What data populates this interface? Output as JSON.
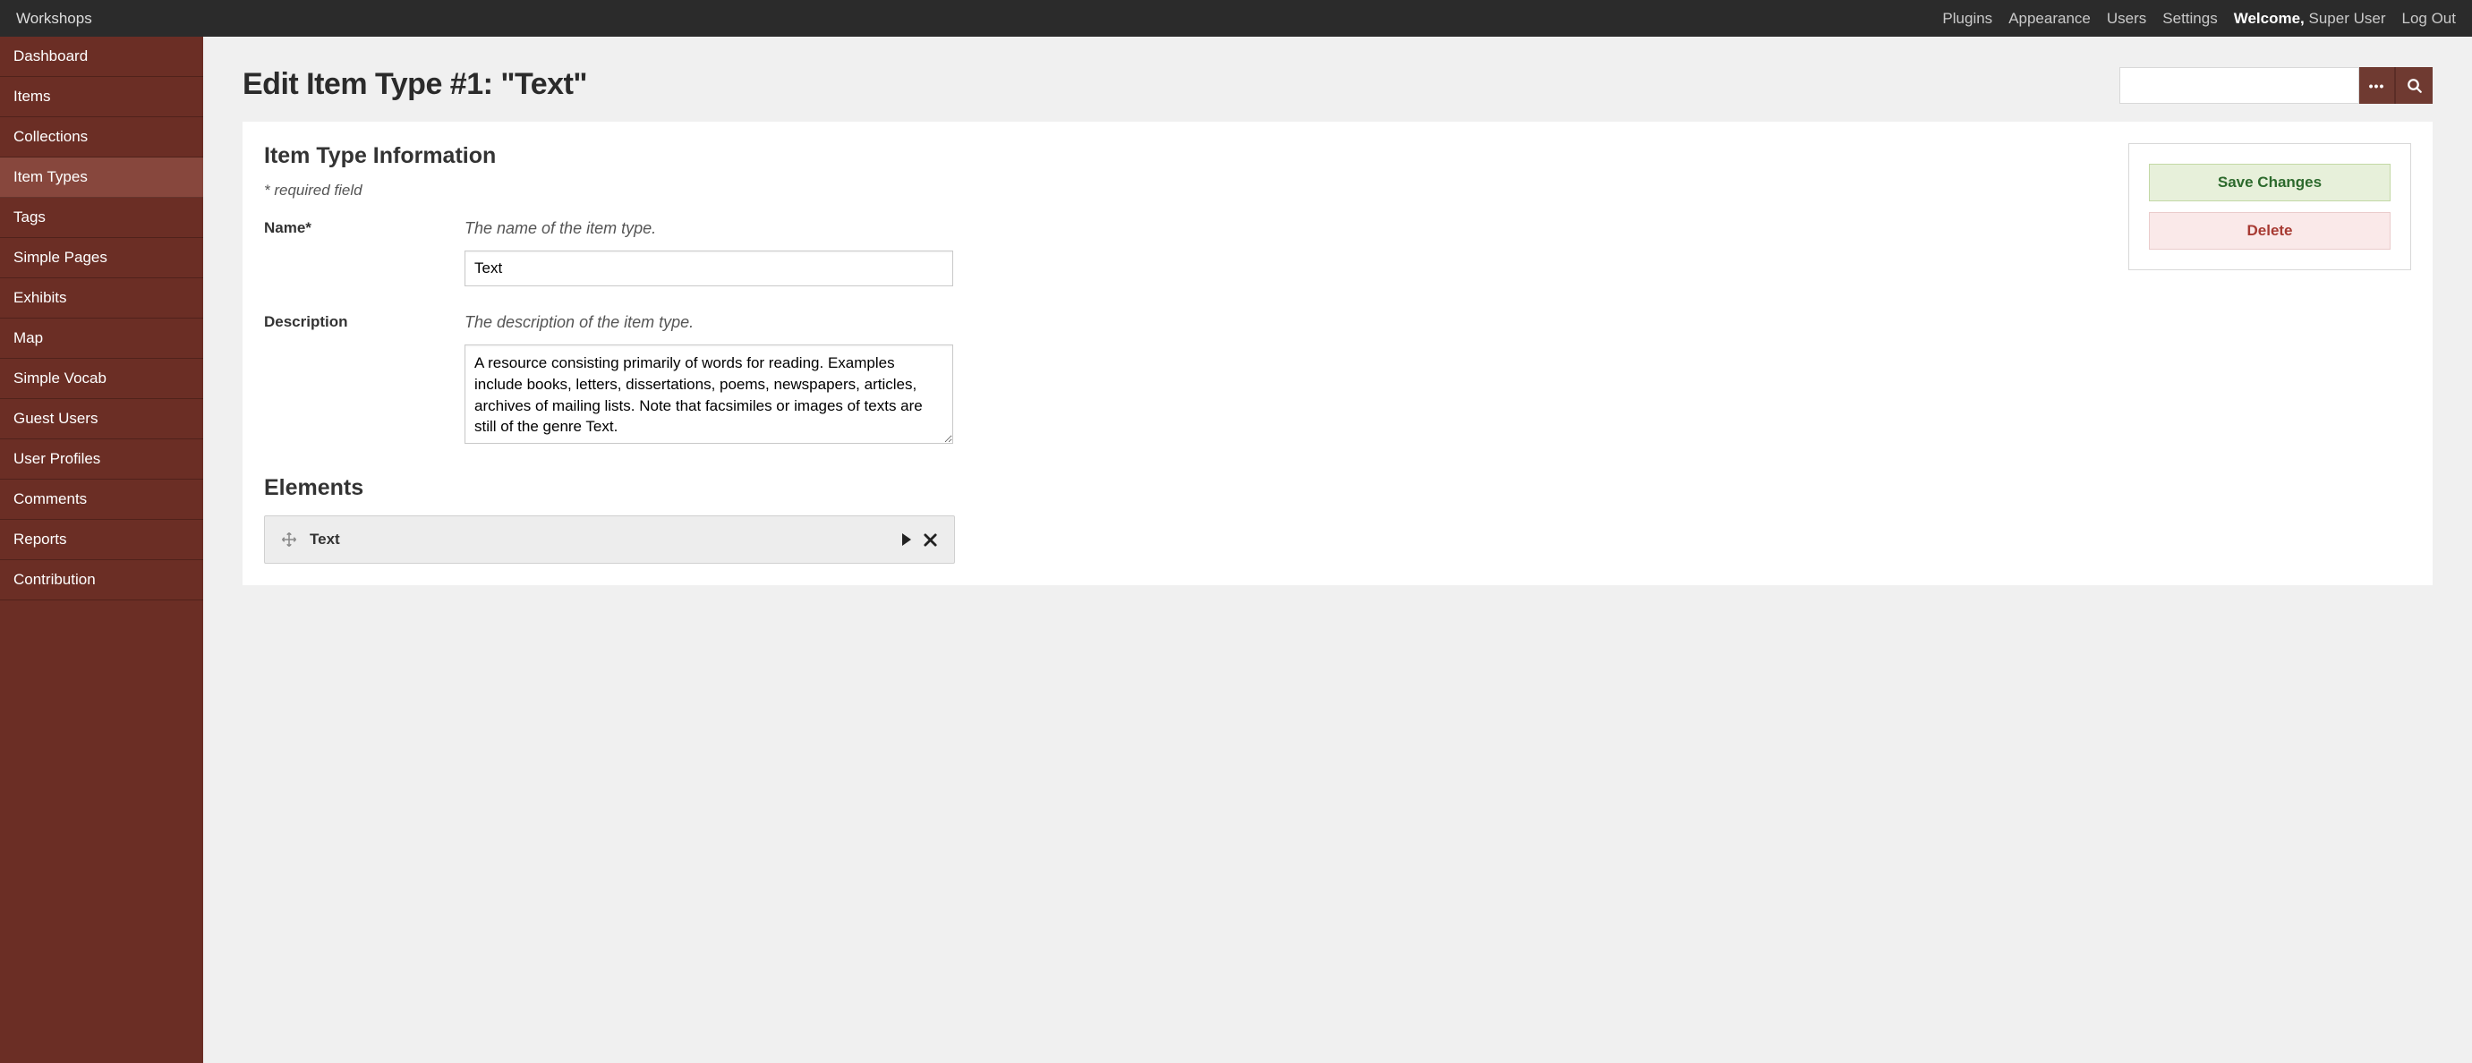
{
  "topbar": {
    "brand": "Workshops",
    "links": {
      "plugins": "Plugins",
      "appearance": "Appearance",
      "users": "Users",
      "settings": "Settings",
      "logout": "Log Out"
    },
    "welcome_label": "Welcome,",
    "welcome_user": "Super User"
  },
  "sidebar": {
    "items": [
      {
        "label": "Dashboard",
        "active": false
      },
      {
        "label": "Items",
        "active": false
      },
      {
        "label": "Collections",
        "active": false
      },
      {
        "label": "Item Types",
        "active": true
      },
      {
        "label": "Tags",
        "active": false
      },
      {
        "label": "Simple Pages",
        "active": false
      },
      {
        "label": "Exhibits",
        "active": false
      },
      {
        "label": "Map",
        "active": false
      },
      {
        "label": "Simple Vocab",
        "active": false
      },
      {
        "label": "Guest Users",
        "active": false
      },
      {
        "label": "User Profiles",
        "active": false
      },
      {
        "label": "Comments",
        "active": false
      },
      {
        "label": "Reports",
        "active": false
      },
      {
        "label": "Contribution",
        "active": false
      }
    ]
  },
  "page": {
    "title": "Edit Item Type #1: \"Text\""
  },
  "search": {
    "value": "",
    "placeholder": ""
  },
  "form": {
    "section_title": "Item Type Information",
    "required_note": "* required field",
    "name": {
      "label": "Name*",
      "help": "The name of the item type.",
      "value": "Text"
    },
    "description": {
      "label": "Description",
      "help": "The description of the item type.",
      "value": "A resource consisting primarily of words for reading. Examples include books, letters, dissertations, poems, newspapers, articles, archives of mailing lists. Note that facsimiles or images of texts are still of the genre Text."
    }
  },
  "actions": {
    "save": "Save Changes",
    "delete": "Delete"
  },
  "elements": {
    "title": "Elements",
    "items": [
      {
        "label": "Text"
      }
    ]
  }
}
